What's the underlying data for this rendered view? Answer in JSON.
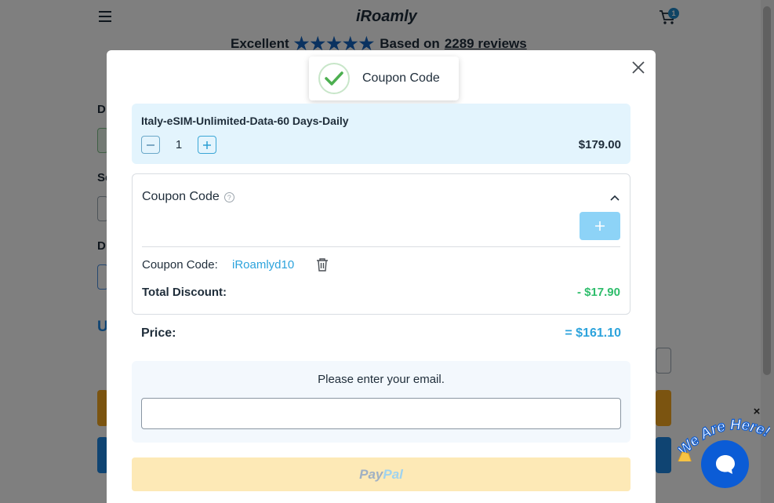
{
  "background": {
    "logo": "iRoamly",
    "cart_count": "1",
    "rating_word": "Excellent",
    "based_on": "Based on",
    "reviews": "2289 reviews",
    "left_fragments": [
      "D",
      "Se",
      "D",
      "U"
    ]
  },
  "toast": {
    "text": "Coupon Code"
  },
  "product": {
    "name": "Italy-eSIM-Unlimited-Data-60 Days-Daily",
    "quantity": "1",
    "price": "$179.00"
  },
  "coupon": {
    "title": "Coupon Code",
    "help_glyph": "?",
    "applied_label": "Coupon Code:",
    "applied_code": "iRoamlyd10",
    "discount_label": "Total Discount:",
    "discount_value": "- $17.90"
  },
  "price": {
    "label": "Price:",
    "value": "= $161.10"
  },
  "email": {
    "prompt": "Please enter your email.",
    "value": ""
  },
  "paypal": {
    "pay": "Pay",
    "pal": "Pal"
  },
  "chat": {
    "banner": "We Are Here!",
    "close": "×"
  },
  "colors": {
    "accent": "#2ca3dc",
    "discount_green": "#2ebd6b",
    "product_bg": "#e3f4fd",
    "paypal_bg": "#fde9b6",
    "chat_blue": "#0b5cd6",
    "star_blue": "#1565c0"
  }
}
